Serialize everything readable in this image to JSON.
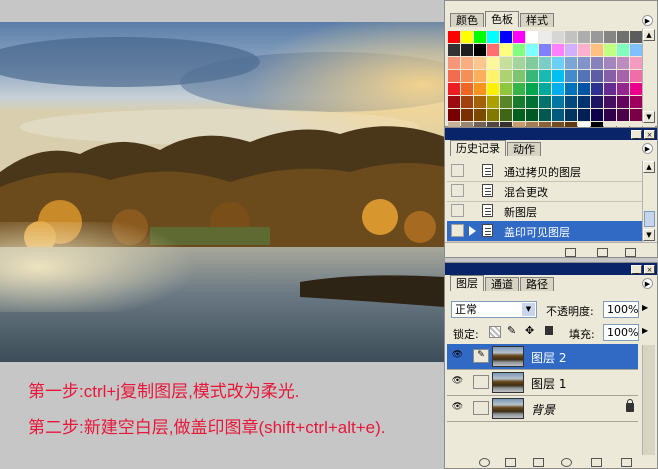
{
  "instructions": {
    "step1": "第一步:ctrl+j复制图层,模式改为柔光.",
    "step2": "第二步:新建空白层,做盖印图章(shift+ctrl+alt+e)."
  },
  "swatches_panel": {
    "tabs": [
      "颜色",
      "色板",
      "样式"
    ],
    "active_tab": "色板"
  },
  "history_panel": {
    "tabs": [
      "历史记录",
      "动作"
    ],
    "active_tab": "历史记录",
    "items": [
      {
        "label": "通过拷贝的图层",
        "selected": false
      },
      {
        "label": "混合更改",
        "selected": false
      },
      {
        "label": "新图层",
        "selected": false
      },
      {
        "label": "盖印可见图层",
        "selected": true
      }
    ]
  },
  "layers_panel": {
    "tabs": [
      "图层",
      "通道",
      "路径"
    ],
    "active_tab": "图层",
    "blend_mode": "正常",
    "opacity_label": "不透明度:",
    "opacity_value": "100%",
    "lock_label": "锁定:",
    "fill_label": "填充:",
    "fill_value": "100%",
    "layers": [
      {
        "name": "图层 2",
        "selected": true,
        "locked": false
      },
      {
        "name": "图层 1",
        "selected": false,
        "locked": false
      },
      {
        "name": "背景",
        "selected": false,
        "locked": true
      }
    ]
  },
  "colors": {
    "selection": "#316ac5",
    "title_bar": "#0a246a",
    "instruction_text": "#e8173a",
    "panel_bg": "#ece9d8"
  }
}
